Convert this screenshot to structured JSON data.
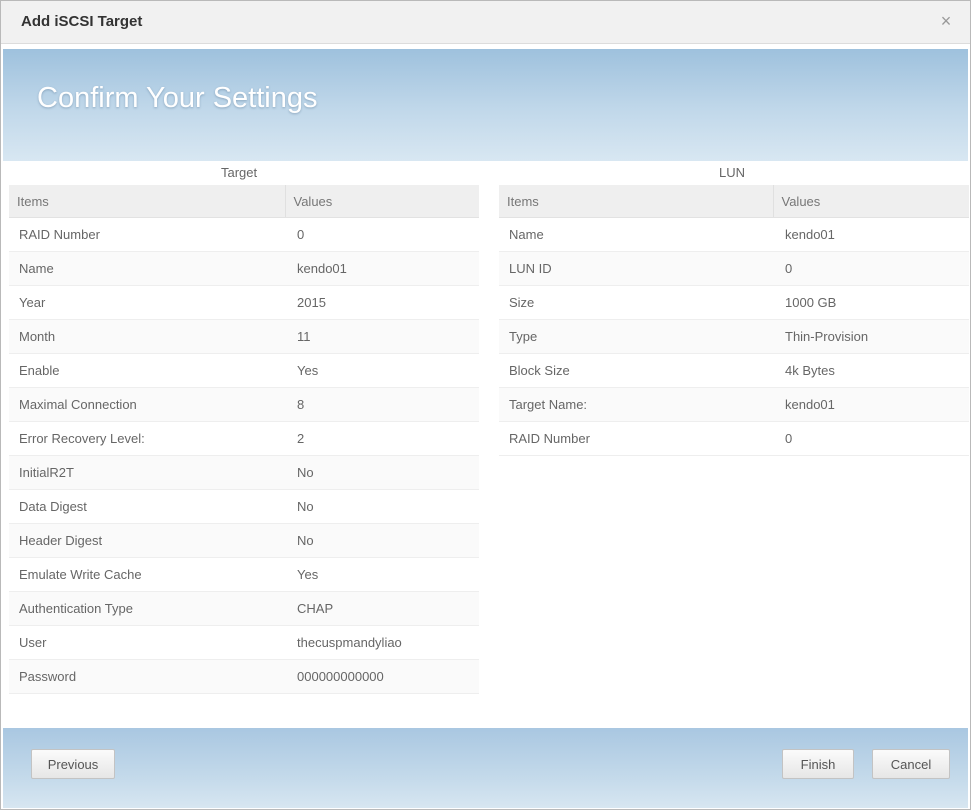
{
  "dialog": {
    "title": "Add iSCSI Target",
    "close_icon": "×",
    "heading": "Confirm Your Settings"
  },
  "target": {
    "section_label": "Target",
    "header_items": "Items",
    "header_values": "Values",
    "rows": [
      {
        "item": "RAID Number",
        "value": "0"
      },
      {
        "item": "Name",
        "value": "kendo01"
      },
      {
        "item": "Year",
        "value": "2015"
      },
      {
        "item": "Month",
        "value": "11"
      },
      {
        "item": "Enable",
        "value": "Yes"
      },
      {
        "item": "Maximal Connection",
        "value": "8"
      },
      {
        "item": "Error Recovery Level:",
        "value": "2"
      },
      {
        "item": "InitialR2T",
        "value": "No"
      },
      {
        "item": "Data Digest",
        "value": "No"
      },
      {
        "item": "Header Digest",
        "value": "No"
      },
      {
        "item": "Emulate Write Cache",
        "value": "Yes"
      },
      {
        "item": "Authentication Type",
        "value": "CHAP"
      },
      {
        "item": "User",
        "value": "thecuspmandyliao"
      },
      {
        "item": "Password",
        "value": "000000000000"
      }
    ]
  },
  "lun": {
    "section_label": "LUN",
    "header_items": "Items",
    "header_values": "Values",
    "rows": [
      {
        "item": "Name",
        "value": "kendo01"
      },
      {
        "item": "LUN ID",
        "value": "0"
      },
      {
        "item": "Size",
        "value": "1000 GB"
      },
      {
        "item": "Type",
        "value": "Thin-Provision"
      },
      {
        "item": "Block Size",
        "value": "4k Bytes"
      },
      {
        "item": "Target Name:",
        "value": "kendo01"
      },
      {
        "item": "RAID Number",
        "value": "0"
      }
    ]
  },
  "footer": {
    "previous_label": "Previous",
    "finish_label": "Finish",
    "cancel_label": "Cancel"
  }
}
